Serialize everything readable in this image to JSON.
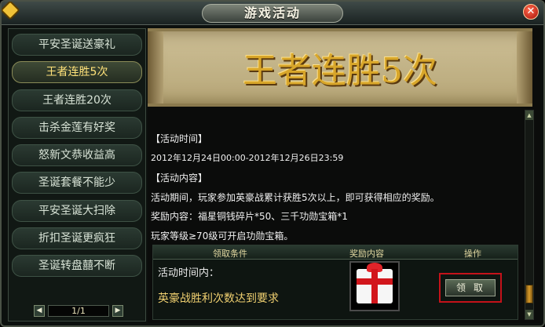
{
  "window": {
    "title": "游戏活动",
    "close_glyph": "✕"
  },
  "sidebar": {
    "items": [
      {
        "label": "平安圣诞送豪礼",
        "active": false
      },
      {
        "label": "王者连胜5次",
        "active": true
      },
      {
        "label": "王者连胜20次",
        "active": false
      },
      {
        "label": "击杀金莲有好奖",
        "active": false
      },
      {
        "label": "怒新文恭收益高",
        "active": false
      },
      {
        "label": "圣诞套餐不能少",
        "active": false
      },
      {
        "label": "平安圣诞大扫除",
        "active": false
      },
      {
        "label": "折扣圣诞更疯狂",
        "active": false
      },
      {
        "label": "圣诞转盘囍不断",
        "active": false
      }
    ],
    "pager": {
      "prev_glyph": "◀",
      "next_glyph": "▶",
      "page_text": "1/1"
    }
  },
  "banner": {
    "title": "王者连胜5次"
  },
  "details": {
    "time_header": "【活动时间】",
    "time_range": "2012年12月24日00:00-2012年12月26日23:59",
    "content_header": "【活动内容】",
    "description": "活动期间，玩家参加英豪战累计获胜5次以上，即可获得相应的奖励。",
    "reward": "奖励内容：福星铜钱碎片*50、三千功勋宝箱*1",
    "level_req": "玩家等级≥70级可开启功勋宝箱。"
  },
  "reward_table": {
    "headers": [
      "领取条件",
      "奖励内容",
      "操作"
    ],
    "row": {
      "condition_line1": "活动时间内：",
      "condition_line2": "英豪战胜利次数达到要求",
      "claim_label": "领取"
    }
  },
  "scrollbar": {
    "up_glyph": "▲",
    "down_glyph": "▼"
  },
  "colors": {
    "accent_gold": "#d8a62a",
    "active_text": "#ffe27a",
    "claim_highlight": "#c4121a"
  }
}
